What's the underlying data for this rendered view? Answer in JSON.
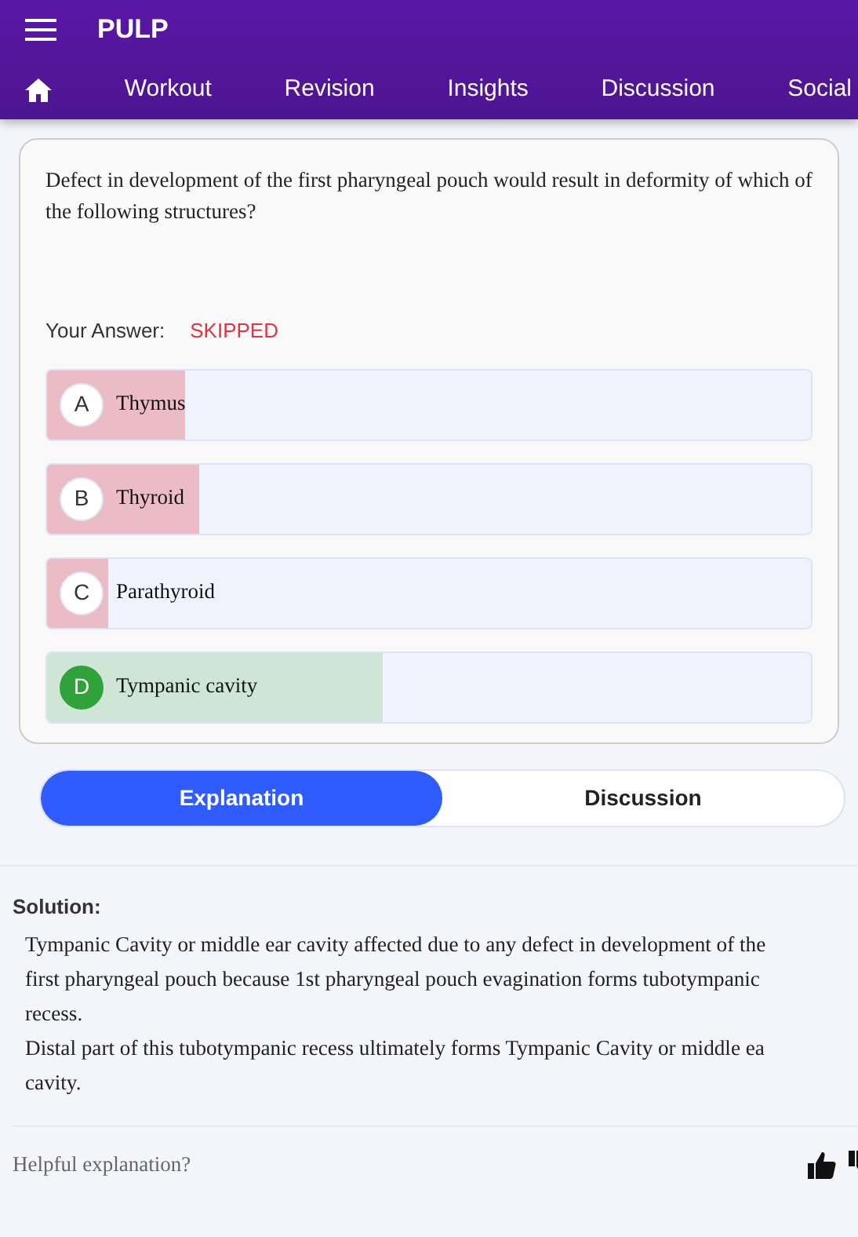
{
  "app_bar": {
    "title": "PULP"
  },
  "nav": [
    {
      "label": "Workout"
    },
    {
      "label": "Revision"
    },
    {
      "label": "Insights"
    },
    {
      "label": "Discussion"
    },
    {
      "label": "Social"
    }
  ],
  "question": {
    "text": "Defect in development of the first pharyngeal pouch would result in deformity of which of the following structures?",
    "answer_label": "Your Answer:",
    "answer_value": "SKIPPED"
  },
  "options": [
    {
      "letter": "A",
      "text": "Thymus",
      "correct": false,
      "level": 0.18
    },
    {
      "letter": "B",
      "text": "Thyroid",
      "correct": false,
      "level": 0.2
    },
    {
      "letter": "C",
      "text": "Parathyroid",
      "correct": false,
      "level": 0.08
    },
    {
      "letter": "D",
      "text": "Tympanic cavity",
      "correct": true,
      "level": 0.44
    }
  ],
  "tabs": [
    {
      "label": "Explanation",
      "selected": true
    },
    {
      "label": "Discussion",
      "selected": false
    }
  ],
  "solution": {
    "heading": "Solution:",
    "lines": [
      "Tympanic Cavity or middle ear cavity affected due to any defect in development of the",
      "first pharyngeal pouch because 1st pharyngeal pouch evagination forms tubotympanic",
      "recess.",
      "Distal part of this tubotympanic recess ultimately forms Tympanic Cavity or middle ea",
      "cavity."
    ]
  },
  "feedback": {
    "prompt": "Helpful explanation?"
  }
}
